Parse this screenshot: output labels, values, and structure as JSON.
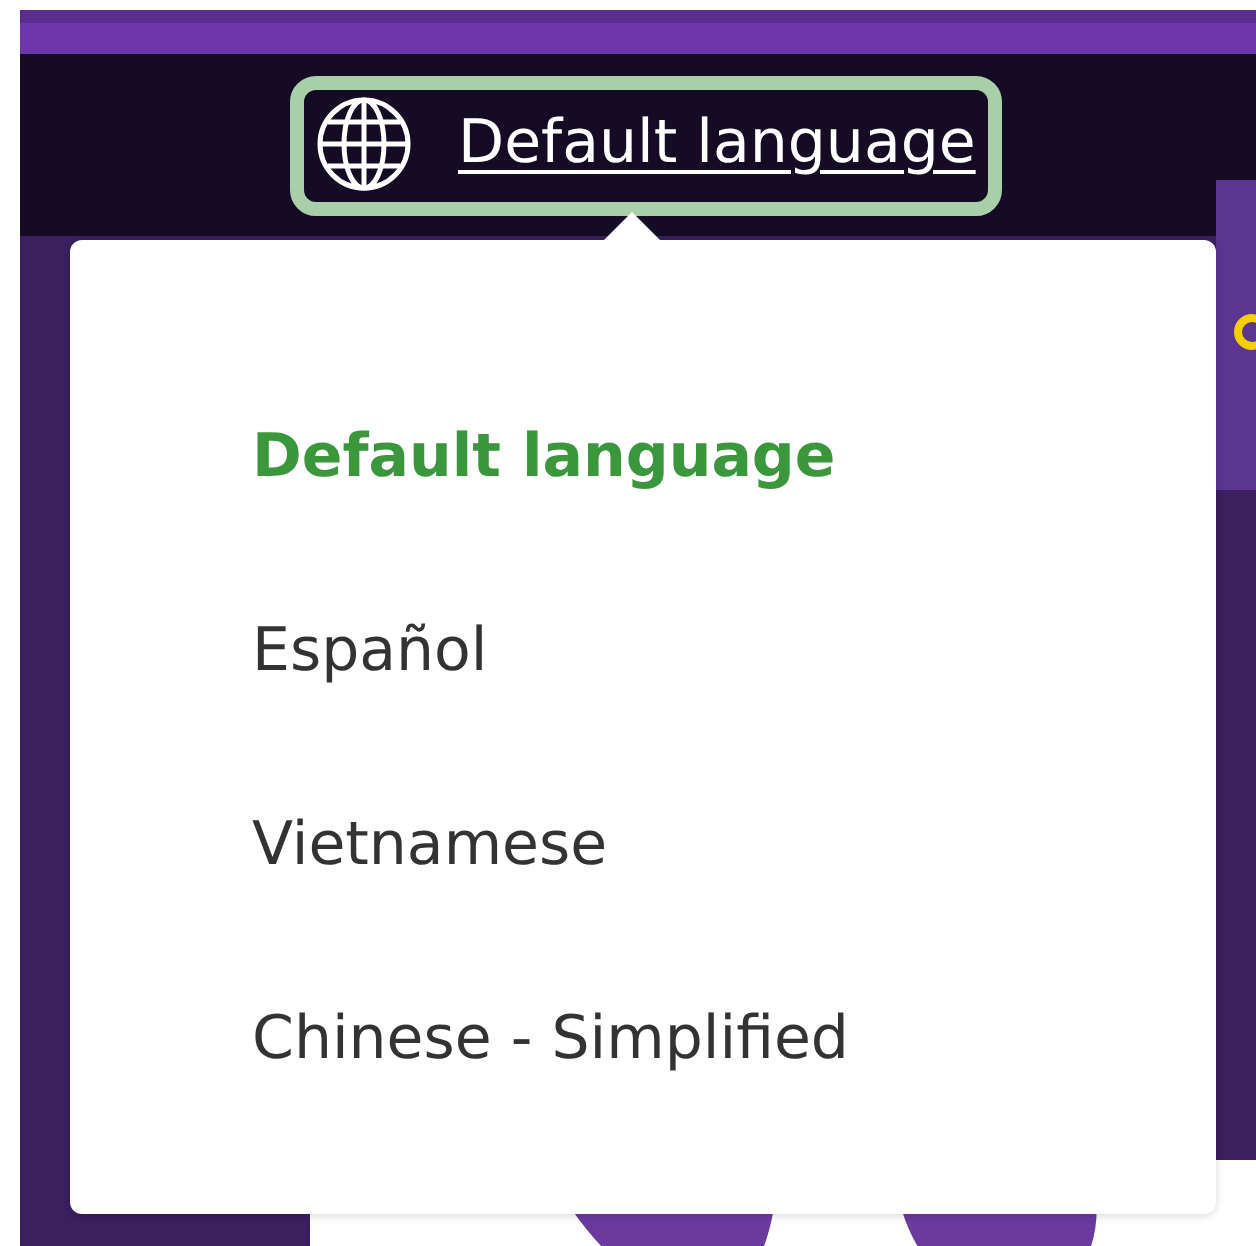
{
  "language_button": {
    "label": "Default language"
  },
  "language_menu": [
    {
      "label": "Default language",
      "selected": true
    },
    {
      "label": "Español",
      "selected": false
    },
    {
      "label": "Vietnamese",
      "selected": false
    },
    {
      "label": "Chinese - Simplified",
      "selected": false
    }
  ]
}
